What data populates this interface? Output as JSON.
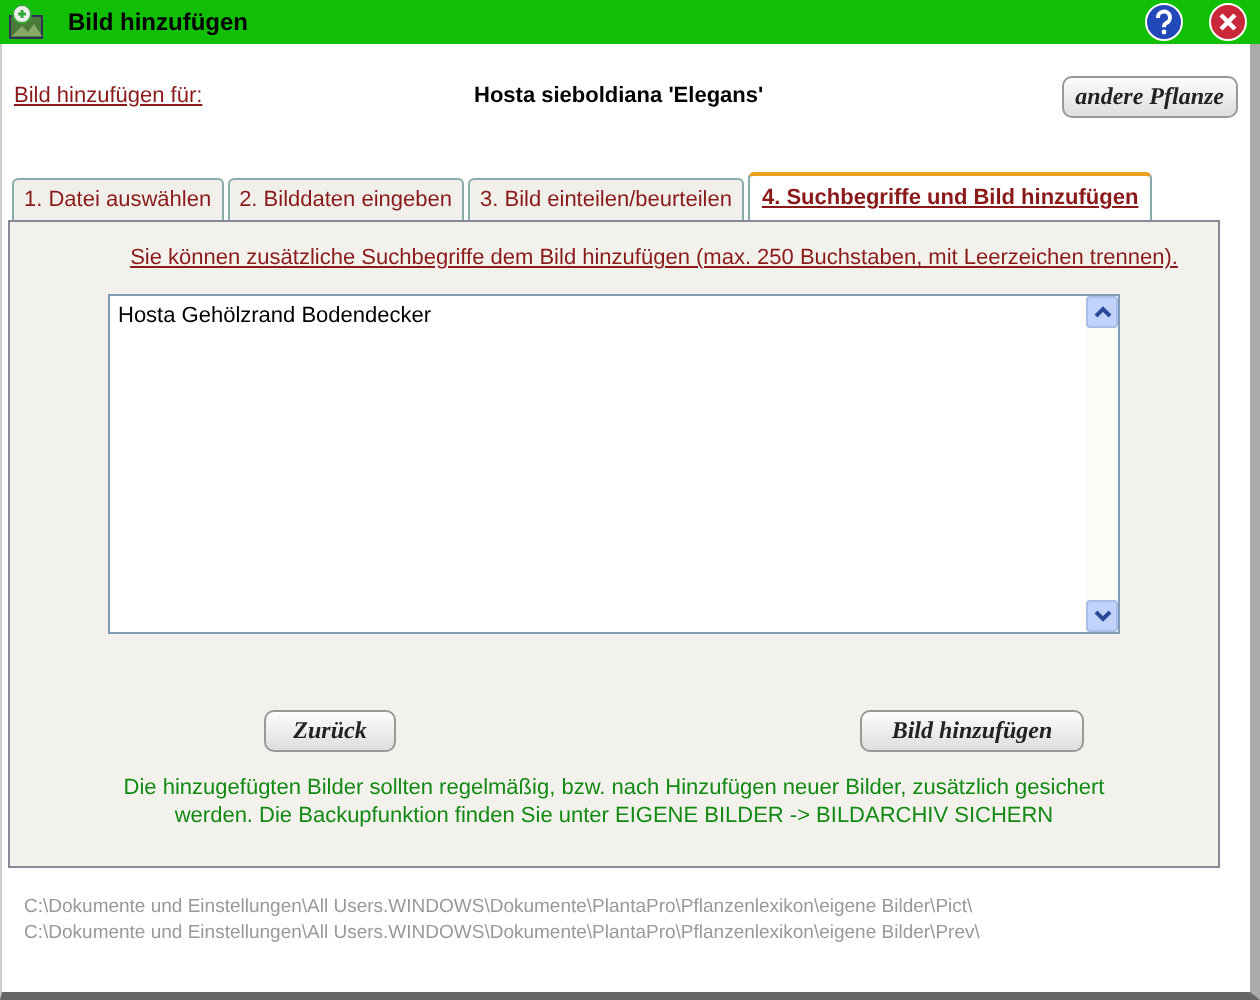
{
  "window": {
    "title": "Bild hinzufügen"
  },
  "header": {
    "label": "Bild hinzufügen für:",
    "plant": "Hosta sieboldiana 'Elegans'",
    "button": "andere Pflanze"
  },
  "tabs": [
    {
      "label": "1. Datei auswählen",
      "selected": false
    },
    {
      "label": "2. Bilddaten eingeben",
      "selected": false
    },
    {
      "label": "3. Bild einteilen/beurteilen",
      "selected": false
    },
    {
      "label": "4. Suchbegriffe und Bild hinzufügen",
      "selected": true
    }
  ],
  "instruction": "Sie können zusätzliche Suchbegriffe dem Bild hinzufügen (max. 250 Buchstaben, mit Leerzeichen trennen).",
  "keywords": {
    "value": "Hosta Gehölzrand Bodendecker"
  },
  "buttons": [
    {
      "label": "Zurück"
    },
    {
      "label": "Bild hinzufügen"
    }
  ],
  "note": "Die hinzugefügten Bilder sollten regelmäßig, bzw. nach Hinzufügen neuer Bilder, zusätzlich gesichert werden. Die Backupfunktion finden Sie unter EIGENE BILDER -> BILDARCHIV SICHERN",
  "paths": [
    "C:\\Dokumente und Einstellungen\\All Users.WINDOWS\\Dokumente\\PlantaPro\\Pflanzenlexikon\\eigene Bilder\\Pict\\",
    "C:\\Dokumente und Einstellungen\\All Users.WINDOWS\\Dokumente\\PlantaPro\\Pflanzenlexikon\\eigene Bilder\\Prev\\"
  ]
}
